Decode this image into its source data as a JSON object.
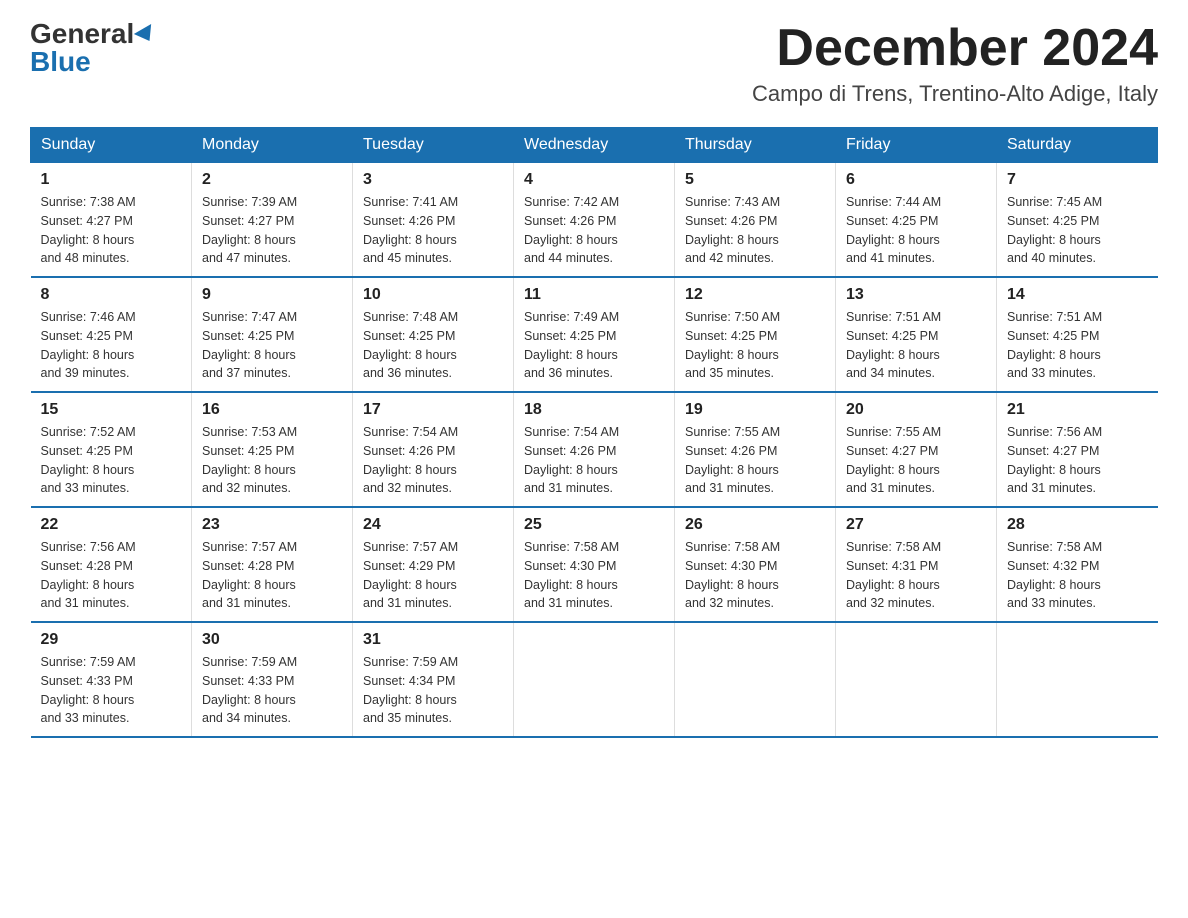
{
  "header": {
    "logo_general": "General",
    "logo_blue": "Blue",
    "month_title": "December 2024",
    "location": "Campo di Trens, Trentino-Alto Adige, Italy"
  },
  "days_of_week": [
    "Sunday",
    "Monday",
    "Tuesday",
    "Wednesday",
    "Thursday",
    "Friday",
    "Saturday"
  ],
  "weeks": [
    [
      {
        "day": "1",
        "sunrise": "7:38 AM",
        "sunset": "4:27 PM",
        "daylight": "8 hours and 48 minutes."
      },
      {
        "day": "2",
        "sunrise": "7:39 AM",
        "sunset": "4:27 PM",
        "daylight": "8 hours and 47 minutes."
      },
      {
        "day": "3",
        "sunrise": "7:41 AM",
        "sunset": "4:26 PM",
        "daylight": "8 hours and 45 minutes."
      },
      {
        "day": "4",
        "sunrise": "7:42 AM",
        "sunset": "4:26 PM",
        "daylight": "8 hours and 44 minutes."
      },
      {
        "day": "5",
        "sunrise": "7:43 AM",
        "sunset": "4:26 PM",
        "daylight": "8 hours and 42 minutes."
      },
      {
        "day": "6",
        "sunrise": "7:44 AM",
        "sunset": "4:25 PM",
        "daylight": "8 hours and 41 minutes."
      },
      {
        "day": "7",
        "sunrise": "7:45 AM",
        "sunset": "4:25 PM",
        "daylight": "8 hours and 40 minutes."
      }
    ],
    [
      {
        "day": "8",
        "sunrise": "7:46 AM",
        "sunset": "4:25 PM",
        "daylight": "8 hours and 39 minutes."
      },
      {
        "day": "9",
        "sunrise": "7:47 AM",
        "sunset": "4:25 PM",
        "daylight": "8 hours and 37 minutes."
      },
      {
        "day": "10",
        "sunrise": "7:48 AM",
        "sunset": "4:25 PM",
        "daylight": "8 hours and 36 minutes."
      },
      {
        "day": "11",
        "sunrise": "7:49 AM",
        "sunset": "4:25 PM",
        "daylight": "8 hours and 36 minutes."
      },
      {
        "day": "12",
        "sunrise": "7:50 AM",
        "sunset": "4:25 PM",
        "daylight": "8 hours and 35 minutes."
      },
      {
        "day": "13",
        "sunrise": "7:51 AM",
        "sunset": "4:25 PM",
        "daylight": "8 hours and 34 minutes."
      },
      {
        "day": "14",
        "sunrise": "7:51 AM",
        "sunset": "4:25 PM",
        "daylight": "8 hours and 33 minutes."
      }
    ],
    [
      {
        "day": "15",
        "sunrise": "7:52 AM",
        "sunset": "4:25 PM",
        "daylight": "8 hours and 33 minutes."
      },
      {
        "day": "16",
        "sunrise": "7:53 AM",
        "sunset": "4:25 PM",
        "daylight": "8 hours and 32 minutes."
      },
      {
        "day": "17",
        "sunrise": "7:54 AM",
        "sunset": "4:26 PM",
        "daylight": "8 hours and 32 minutes."
      },
      {
        "day": "18",
        "sunrise": "7:54 AM",
        "sunset": "4:26 PM",
        "daylight": "8 hours and 31 minutes."
      },
      {
        "day": "19",
        "sunrise": "7:55 AM",
        "sunset": "4:26 PM",
        "daylight": "8 hours and 31 minutes."
      },
      {
        "day": "20",
        "sunrise": "7:55 AM",
        "sunset": "4:27 PM",
        "daylight": "8 hours and 31 minutes."
      },
      {
        "day": "21",
        "sunrise": "7:56 AM",
        "sunset": "4:27 PM",
        "daylight": "8 hours and 31 minutes."
      }
    ],
    [
      {
        "day": "22",
        "sunrise": "7:56 AM",
        "sunset": "4:28 PM",
        "daylight": "8 hours and 31 minutes."
      },
      {
        "day": "23",
        "sunrise": "7:57 AM",
        "sunset": "4:28 PM",
        "daylight": "8 hours and 31 minutes."
      },
      {
        "day": "24",
        "sunrise": "7:57 AM",
        "sunset": "4:29 PM",
        "daylight": "8 hours and 31 minutes."
      },
      {
        "day": "25",
        "sunrise": "7:58 AM",
        "sunset": "4:30 PM",
        "daylight": "8 hours and 31 minutes."
      },
      {
        "day": "26",
        "sunrise": "7:58 AM",
        "sunset": "4:30 PM",
        "daylight": "8 hours and 32 minutes."
      },
      {
        "day": "27",
        "sunrise": "7:58 AM",
        "sunset": "4:31 PM",
        "daylight": "8 hours and 32 minutes."
      },
      {
        "day": "28",
        "sunrise": "7:58 AM",
        "sunset": "4:32 PM",
        "daylight": "8 hours and 33 minutes."
      }
    ],
    [
      {
        "day": "29",
        "sunrise": "7:59 AM",
        "sunset": "4:33 PM",
        "daylight": "8 hours and 33 minutes."
      },
      {
        "day": "30",
        "sunrise": "7:59 AM",
        "sunset": "4:33 PM",
        "daylight": "8 hours and 34 minutes."
      },
      {
        "day": "31",
        "sunrise": "7:59 AM",
        "sunset": "4:34 PM",
        "daylight": "8 hours and 35 minutes."
      },
      null,
      null,
      null,
      null
    ]
  ],
  "labels": {
    "sunrise_prefix": "Sunrise: ",
    "sunset_prefix": "Sunset: ",
    "daylight_prefix": "Daylight: "
  }
}
